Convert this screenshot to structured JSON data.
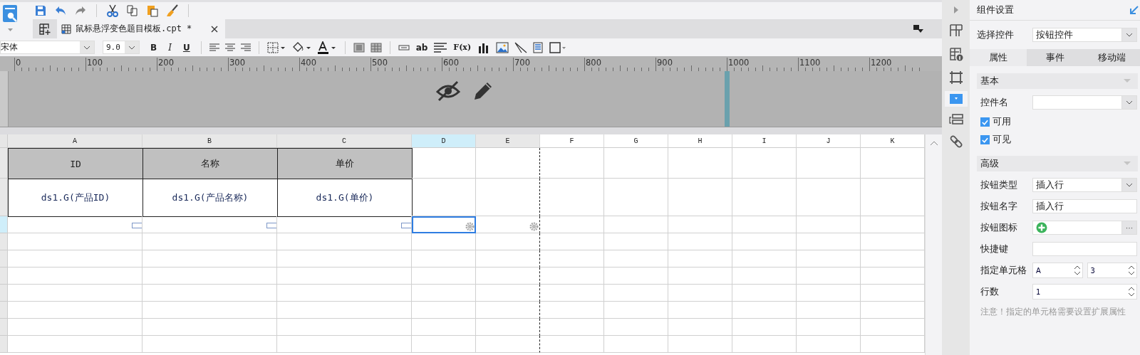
{
  "document_tab": {
    "title": "鼠标悬浮变色题目模板.cpt *",
    "selected": true
  },
  "format_bar": {
    "font": "宋体",
    "size": "9.0",
    "style_buttons": [
      "B",
      "I",
      "U"
    ],
    "text_button": "ab",
    "formula_button": "F(x)"
  },
  "ruler": {
    "labels": [
      "0",
      "100",
      "200",
      "300",
      "400",
      "500",
      "600",
      "700",
      "800",
      "900",
      "1000",
      "1100",
      "1200"
    ]
  },
  "sheet": {
    "columns": [
      {
        "label": "A",
        "selected": false,
        "in_page": true
      },
      {
        "label": "B",
        "selected": false,
        "in_page": true
      },
      {
        "label": "C",
        "selected": false,
        "in_page": true
      },
      {
        "label": "D",
        "selected": true,
        "in_page": true
      },
      {
        "label": "E",
        "selected": false,
        "in_page": true
      },
      {
        "label": "F",
        "selected": false,
        "in_page": false
      },
      {
        "label": "G",
        "selected": false,
        "in_page": false
      },
      {
        "label": "H",
        "selected": false,
        "in_page": false
      },
      {
        "label": "I",
        "selected": false,
        "in_page": false
      },
      {
        "label": "J",
        "selected": false,
        "in_page": false
      },
      {
        "label": "K",
        "selected": false,
        "in_page": false
      }
    ],
    "rows": [
      {
        "selected": false
      },
      {
        "selected": false
      },
      {
        "selected": true
      },
      {
        "selected": false
      },
      {
        "selected": false
      },
      {
        "selected": false
      },
      {
        "selected": false
      },
      {
        "selected": false
      },
      {
        "selected": false
      },
      {
        "selected": false
      }
    ],
    "header": [
      "ID",
      "名称",
      "单价"
    ],
    "data": [
      "ds1.G(产品ID)",
      "ds1.G(产品名称)",
      "ds1.G(单价)"
    ]
  },
  "panel": {
    "title": "组件设置",
    "control_select": {
      "label": "选择控件",
      "value": "按钮控件"
    },
    "tabs": [
      {
        "label": "属性",
        "selected": true
      },
      {
        "label": "事件",
        "selected": false
      },
      {
        "label": "移动端",
        "selected": false
      }
    ],
    "sections": [
      {
        "title": "基本",
        "fields": [
          {
            "kind": "select",
            "label": "控件名"
          },
          {
            "kind": "checkbox",
            "label": "可用",
            "checked": true
          },
          {
            "kind": "checkbox",
            "label": "可见",
            "checked": true
          }
        ]
      },
      {
        "title": "高级",
        "fields": [
          {
            "kind": "select",
            "label": "按钮类型",
            "value": "插入行"
          },
          {
            "kind": "text",
            "label": "按钮名字",
            "value": "插入行"
          },
          {
            "kind": "icon",
            "label": "按钮图标",
            "more": "···"
          },
          {
            "kind": "text",
            "label": "快捷键"
          },
          {
            "kind": "pair",
            "label": "指定单元格",
            "values": [
              "A",
              "3"
            ]
          },
          {
            "kind": "spinner",
            "label": "行数",
            "value": "1"
          }
        ],
        "note": "注意！指定的单元格需要设置扩展属性"
      }
    ]
  }
}
